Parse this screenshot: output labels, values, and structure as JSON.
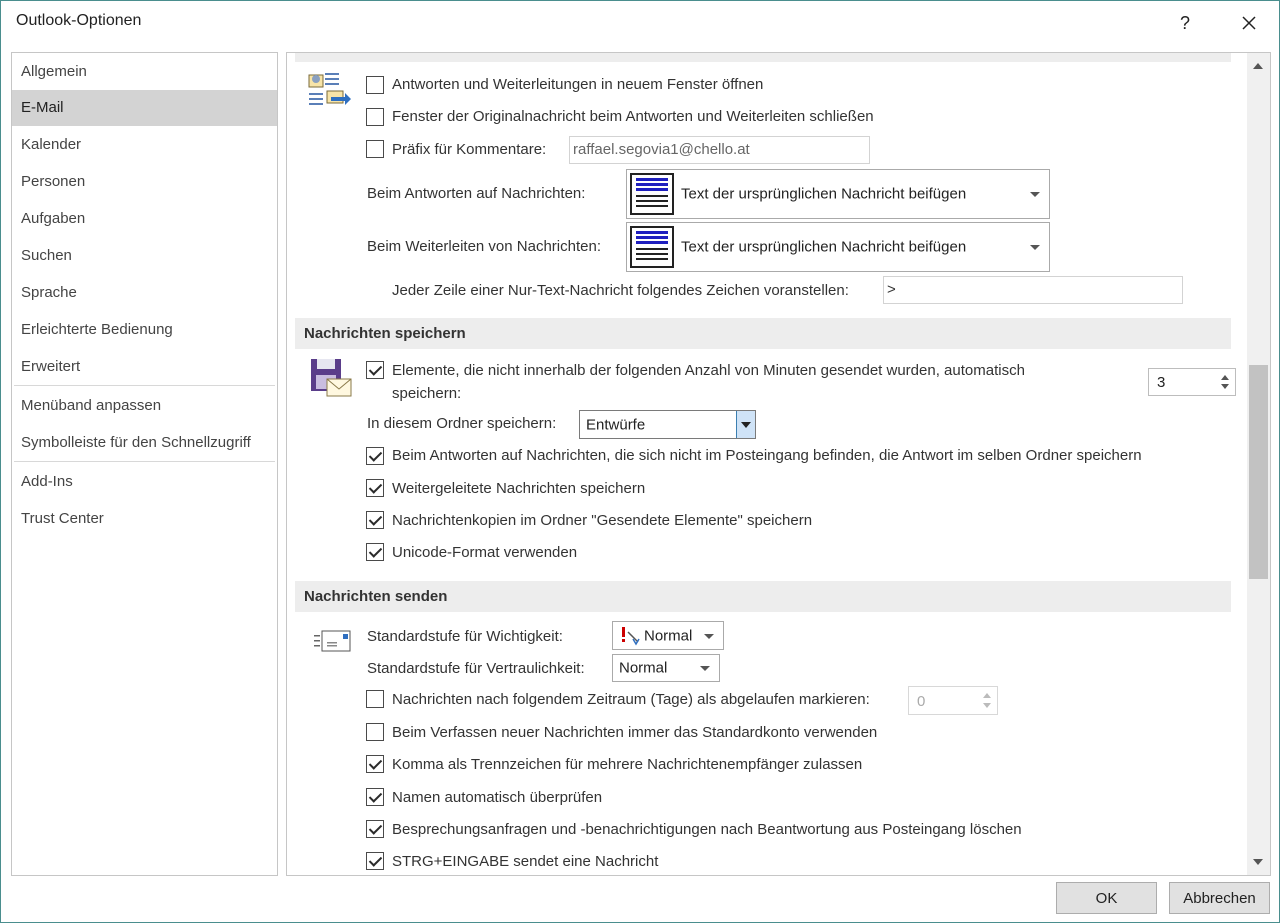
{
  "window": {
    "title": "Outlook-Optionen",
    "help_label": "?",
    "close_label": "✕"
  },
  "nav": {
    "items": [
      "Allgemein",
      "E-Mail",
      "Kalender",
      "Personen",
      "Aufgaben",
      "Suchen",
      "Sprache",
      "Erleichterte Bedienung",
      "Erweitert",
      "Menüband anpassen",
      "Symbolleiste für den Schnellzugriff",
      "Add-Ins",
      "Trust Center"
    ],
    "selected": "E-Mail"
  },
  "replies": {
    "open_new_window": "Antworten und Weiterleitungen in neuem Fenster öffnen",
    "close_original": "Fenster der Originalnachricht beim Antworten und Weiterleiten schließen",
    "prefix_label": "Präfix für Kommentare:",
    "prefix_value": "raffael.segovia1@chello.at",
    "reply_label": "Beim Antworten auf Nachrichten:",
    "reply_value": "Text der ursprünglichen Nachricht beifügen",
    "forward_label": "Beim Weiterleiten von Nachrichten:",
    "forward_value": "Text der ursprünglichen Nachricht beifügen",
    "plaintext_label": "Jeder Zeile einer Nur-Text-Nachricht folgendes Zeichen voranstellen:",
    "plaintext_value": ">"
  },
  "save": {
    "heading": "Nachrichten speichern",
    "autosave_line1": "Elemente, die nicht innerhalb der folgenden Anzahl von Minuten gesendet wurden, automatisch",
    "autosave_line2": "speichern:",
    "autosave_minutes": "3",
    "folder_label": "In diesem Ordner speichern:",
    "folder_value": "Entwürfe",
    "reply_same_folder": "Beim Antworten auf Nachrichten, die sich nicht im Posteingang befinden, die Antwort im selben Ordner speichern",
    "save_forwarded": "Weitergeleitete Nachrichten speichern",
    "save_sent_copies": "Nachrichtenkopien im Ordner \"Gesendete Elemente\" speichern",
    "unicode": "Unicode-Format verwenden"
  },
  "send": {
    "heading": "Nachrichten senden",
    "importance_label": "Standardstufe für Wichtigkeit:",
    "importance_value": "Normal",
    "sensitivity_label": "Standardstufe für Vertraulichkeit:",
    "sensitivity_value": "Normal",
    "expire_label": "Nachrichten nach folgendem Zeitraum (Tage) als abgelaufen markieren:",
    "expire_value": "0",
    "default_account": "Beim Verfassen neuer Nachrichten immer das Standardkonto verwenden",
    "comma_separator": "Komma als Trennzeichen für mehrere Nachrichtenempfänger zulassen",
    "check_names": "Namen automatisch überprüfen",
    "delete_meeting": "Besprechungsanfragen und -benachrichtigungen nach Beantwortung aus Posteingang löschen",
    "ctrl_enter": "STRG+EINGABE sendet eine Nachricht"
  },
  "footer": {
    "ok_label": "OK",
    "cancel_label": "Abbrechen"
  }
}
